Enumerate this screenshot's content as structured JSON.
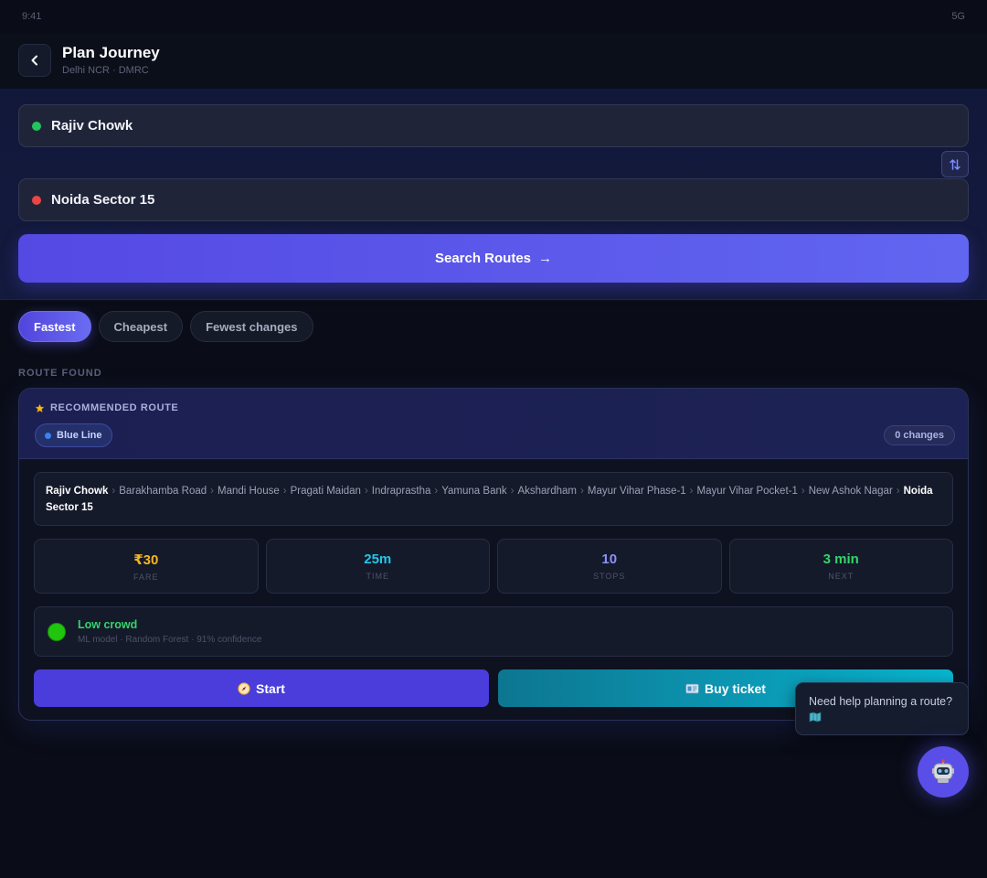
{
  "status": {
    "time": "9:41",
    "network": "5G"
  },
  "header": {
    "title": "Plan Journey",
    "subtitle": "Delhi NCR · DMRC"
  },
  "search": {
    "from": "Rajiv Chowk",
    "to": "Noida Sector 15",
    "button_label": "Search Routes",
    "button_arrow": "→",
    "from_color": "#22c55e",
    "to_color": "#ef4444"
  },
  "tabs": [
    {
      "label": "Fastest",
      "active": true
    },
    {
      "label": "Cheapest",
      "active": false
    },
    {
      "label": "Fewest changes",
      "active": false
    }
  ],
  "section_label": "ROUTE FOUND",
  "route": {
    "recommended_label": "RECOMMENDED ROUTE",
    "line_name": "Blue Line",
    "line_color": "#3b82f6",
    "changes": "0 changes",
    "stations": [
      "Rajiv Chowk",
      "Barakhamba Road",
      "Mandi House",
      "Pragati Maidan",
      "Indraprastha",
      "Yamuna Bank",
      "Akshardham",
      "Mayur Vihar Phase-1",
      "Mayur Vihar Pocket-1",
      "New Ashok Nagar",
      "Noida Sector 15"
    ],
    "stats": [
      {
        "value": "₹30",
        "label": "FARE",
        "color": "#f5b71f"
      },
      {
        "value": "25m",
        "label": "TIME",
        "color": "#22c6e8"
      },
      {
        "value": "10",
        "label": "STOPS",
        "color": "#8b92f6"
      },
      {
        "value": "3 min",
        "label": "NEXT",
        "color": "#35d46a"
      }
    ],
    "crowd": {
      "title": "Low crowd",
      "subtitle": "ML model · Random Forest · 91% confidence"
    },
    "start_label": "Start",
    "ticket_label": "Buy ticket"
  },
  "assistant": {
    "tooltip": "Need help planning a route?"
  }
}
